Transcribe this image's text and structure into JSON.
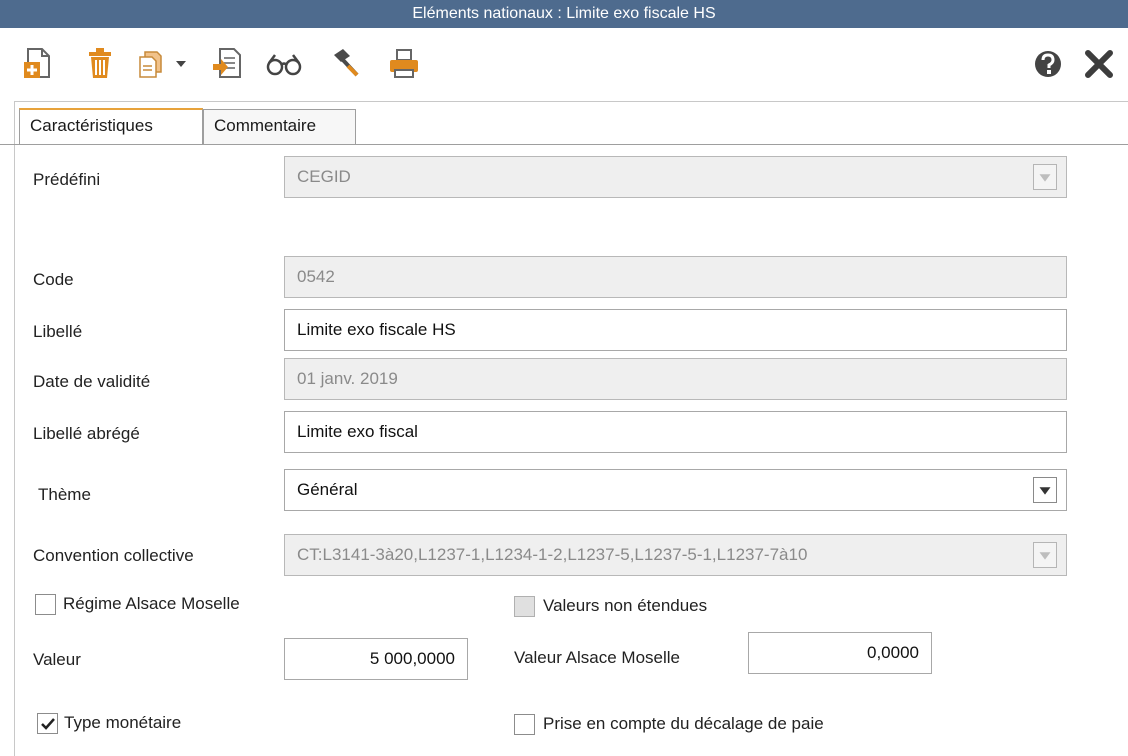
{
  "window": {
    "title": "Eléments nationaux  :  Limite exo fiscale HS"
  },
  "toolbar": {
    "icons": [
      "new-icon",
      "delete-icon",
      "duplicate-icon",
      "dropdown-arrow-icon",
      "import-icon",
      "glasses-icon",
      "hammer-icon",
      "printer-icon",
      "help-icon",
      "close-icon"
    ]
  },
  "tabs": [
    {
      "label": "Caractéristiques",
      "active": true
    },
    {
      "label": "Commentaire",
      "active": false
    }
  ],
  "form": {
    "predefini": {
      "label": "Prédéfini",
      "value": "CEGID"
    },
    "code": {
      "label": "Code",
      "value": "0542"
    },
    "libelle": {
      "label": "Libellé",
      "value": "Limite exo fiscale HS"
    },
    "date_validite": {
      "label": "Date de validité",
      "value": "01 janv. 2019"
    },
    "libelle_abrege": {
      "label": "Libellé abrégé",
      "value": "Limite exo fiscal"
    },
    "theme": {
      "label": "Thème",
      "value": "Général"
    },
    "convention": {
      "label": "Convention collective",
      "value": "CT:L3141-3à20,L1237-1,L1234-1-2,L1237-5,L1237-5-1,L1237-7à10"
    },
    "regime_alsace": {
      "label": "Régime Alsace Moselle",
      "checked": false
    },
    "valeurs_non_etendues": {
      "label": "Valeurs non étendues",
      "checked": false
    },
    "valeur": {
      "label": "Valeur",
      "value": "5 000,0000"
    },
    "valeur_alsace": {
      "label": "Valeur Alsace Moselle",
      "value": "0,0000"
    },
    "type_monetaire": {
      "label": "Type monétaire",
      "checked": true
    },
    "decalage_paie": {
      "label": "Prise en compte du décalage de paie",
      "checked": false
    }
  },
  "colors": {
    "titlebar": "#4e6b8e",
    "accent_tab": "#e8a33b",
    "icon_orange": "#e08a1e",
    "icon_dark": "#4a4a4a"
  }
}
